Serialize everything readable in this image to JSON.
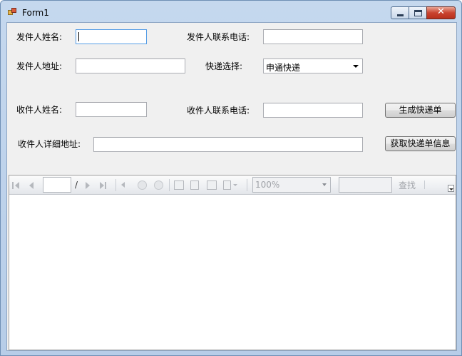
{
  "window": {
    "title": "Form1"
  },
  "form": {
    "sender_name_label": "发件人姓名:",
    "sender_phone_label": "发件人联系电话:",
    "sender_address_label": "发件人地址:",
    "courier_select_label": "快递选择:",
    "courier_selected": "申通快递",
    "recipient_name_label": "收件人姓名:",
    "recipient_phone_label": "收件人联系电话:",
    "recipient_address_label": "收件人详细地址:",
    "sender_name_value": "",
    "sender_phone_value": "",
    "sender_address_value": "",
    "recipient_name_value": "",
    "recipient_phone_value": "",
    "recipient_address_value": "",
    "generate_button": "生成快递单",
    "fetch_button": "获取快递单信息"
  },
  "report_toolbar": {
    "page_separator": "/",
    "zoom_value": "100%",
    "find_label": "查找",
    "icons": [
      "first-page-icon",
      "previous-page-icon",
      "next-page-icon",
      "last-page-icon",
      "back-icon",
      "stop-icon",
      "refresh-icon",
      "print-icon",
      "print-layout-icon",
      "page-setup-icon",
      "export-icon"
    ]
  }
}
